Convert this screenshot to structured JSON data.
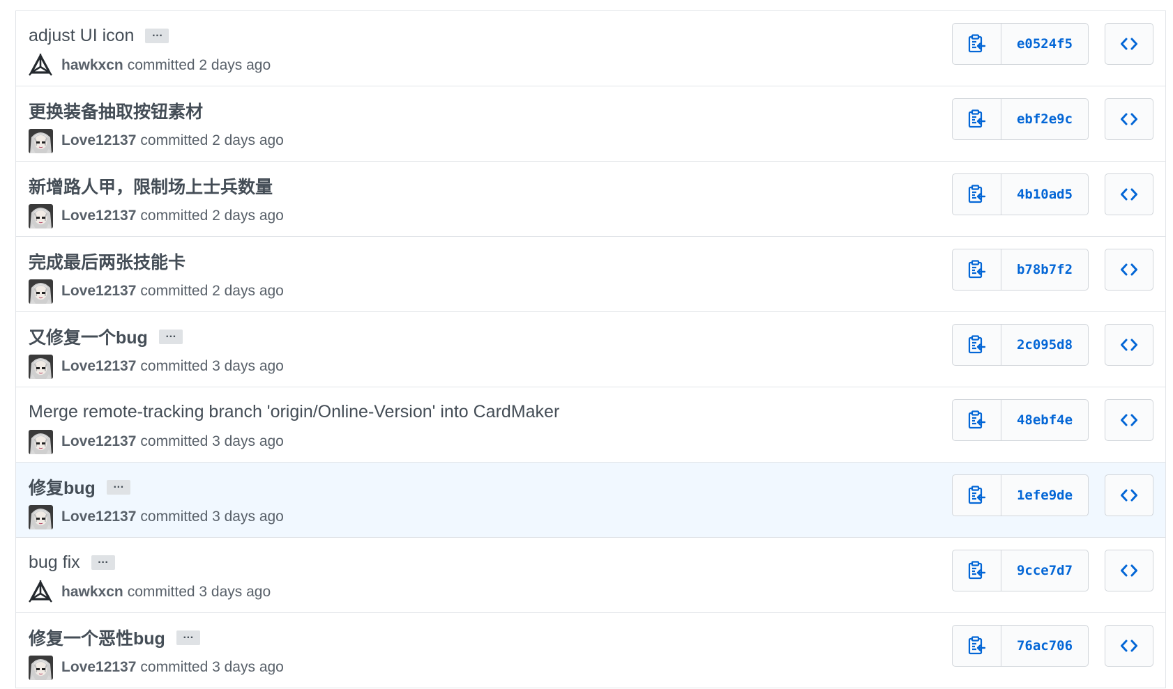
{
  "colors": {
    "link": "#0366d6",
    "border": "#e1e4e8",
    "highlight_row": "#f1f8ff",
    "muted_text": "#586069"
  },
  "commits": [
    {
      "title": "adjust UI icon",
      "has_ellipsis": true,
      "ellipsis": "…",
      "author": "hawkxcn",
      "avatar": "unity-logo-icon",
      "committed": "committed 2 days ago",
      "sha": "e0524f5"
    },
    {
      "title": "更换装备抽取按钮素材",
      "has_ellipsis": false,
      "ellipsis": "",
      "author": "Love12137",
      "avatar": "anime-avatar",
      "committed": "committed 2 days ago",
      "sha": "ebf2e9c"
    },
    {
      "title": "新增路人甲，限制场上士兵数量",
      "has_ellipsis": false,
      "ellipsis": "",
      "author": "Love12137",
      "avatar": "anime-avatar",
      "committed": "committed 2 days ago",
      "sha": "4b10ad5"
    },
    {
      "title": "完成最后两张技能卡",
      "has_ellipsis": false,
      "ellipsis": "",
      "author": "Love12137",
      "avatar": "anime-avatar",
      "committed": "committed 2 days ago",
      "sha": "b78b7f2"
    },
    {
      "title": "又修复一个bug",
      "has_ellipsis": true,
      "ellipsis": "…",
      "author": "Love12137",
      "avatar": "anime-avatar",
      "committed": "committed 3 days ago",
      "sha": "2c095d8"
    },
    {
      "title": "Merge remote-tracking branch 'origin/Online-Version' into CardMaker",
      "has_ellipsis": false,
      "ellipsis": "",
      "author": "Love12137",
      "avatar": "anime-avatar",
      "committed": "committed 3 days ago",
      "sha": "48ebf4e"
    },
    {
      "title": "修复bug",
      "has_ellipsis": true,
      "ellipsis": "…",
      "author": "Love12137",
      "avatar": "anime-avatar",
      "committed": "committed 3 days ago",
      "sha": "1efe9de",
      "highlighted": true
    },
    {
      "title": "bug fix",
      "has_ellipsis": true,
      "ellipsis": "…",
      "author": "hawkxcn",
      "avatar": "unity-logo-icon",
      "committed": "committed 3 days ago",
      "sha": "9cce7d7"
    },
    {
      "title": "修复一个恶性bug",
      "has_ellipsis": true,
      "ellipsis": "…",
      "author": "Love12137",
      "avatar": "anime-avatar",
      "committed": "committed 3 days ago",
      "sha": "76ac706"
    }
  ]
}
